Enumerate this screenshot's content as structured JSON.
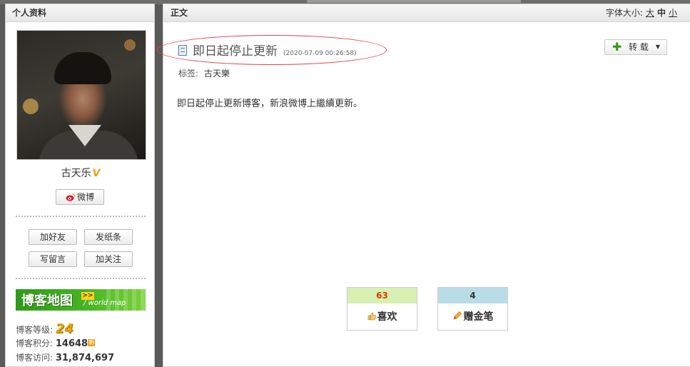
{
  "sidebar": {
    "header": "个人资料",
    "username": "古天乐",
    "verified_mark": "V",
    "weibo_label": "微博",
    "actions": [
      "加好友",
      "发纸条",
      "写留言",
      "加关注"
    ],
    "map_banner": {
      "title": "博客地图",
      "arrow": ">>",
      "subtitle": "/ world map"
    },
    "stats": {
      "level_label": "博客等级:",
      "level_value": "24",
      "points_label": "博客积分:",
      "points_value": "14648",
      "new_badge": "新",
      "visits_label": "博客访问:",
      "visits_value": "31,874,697"
    }
  },
  "main": {
    "header": "正文",
    "font_size": {
      "label": "字体大小:",
      "large": "大",
      "medium": "中",
      "small": "小",
      "active": "medium"
    },
    "title": "即日起停止更新",
    "timestamp": "(2020-07-09 00:26:58)",
    "repost_label": "转 载",
    "tags_label": "标签:",
    "tag": "古天樂",
    "body": "即日起停止更新博客，新浪微博上繼續更新。",
    "like": {
      "count": "63",
      "label": "喜欢"
    },
    "gold_pen": {
      "count": "4",
      "label": "赠金笔"
    }
  },
  "colors": {
    "accent_green": "#3a9a1a",
    "annotation_oval": "#e0404a",
    "like_bg": "#d8f0b2",
    "pen_bg": "#b9dde8"
  }
}
